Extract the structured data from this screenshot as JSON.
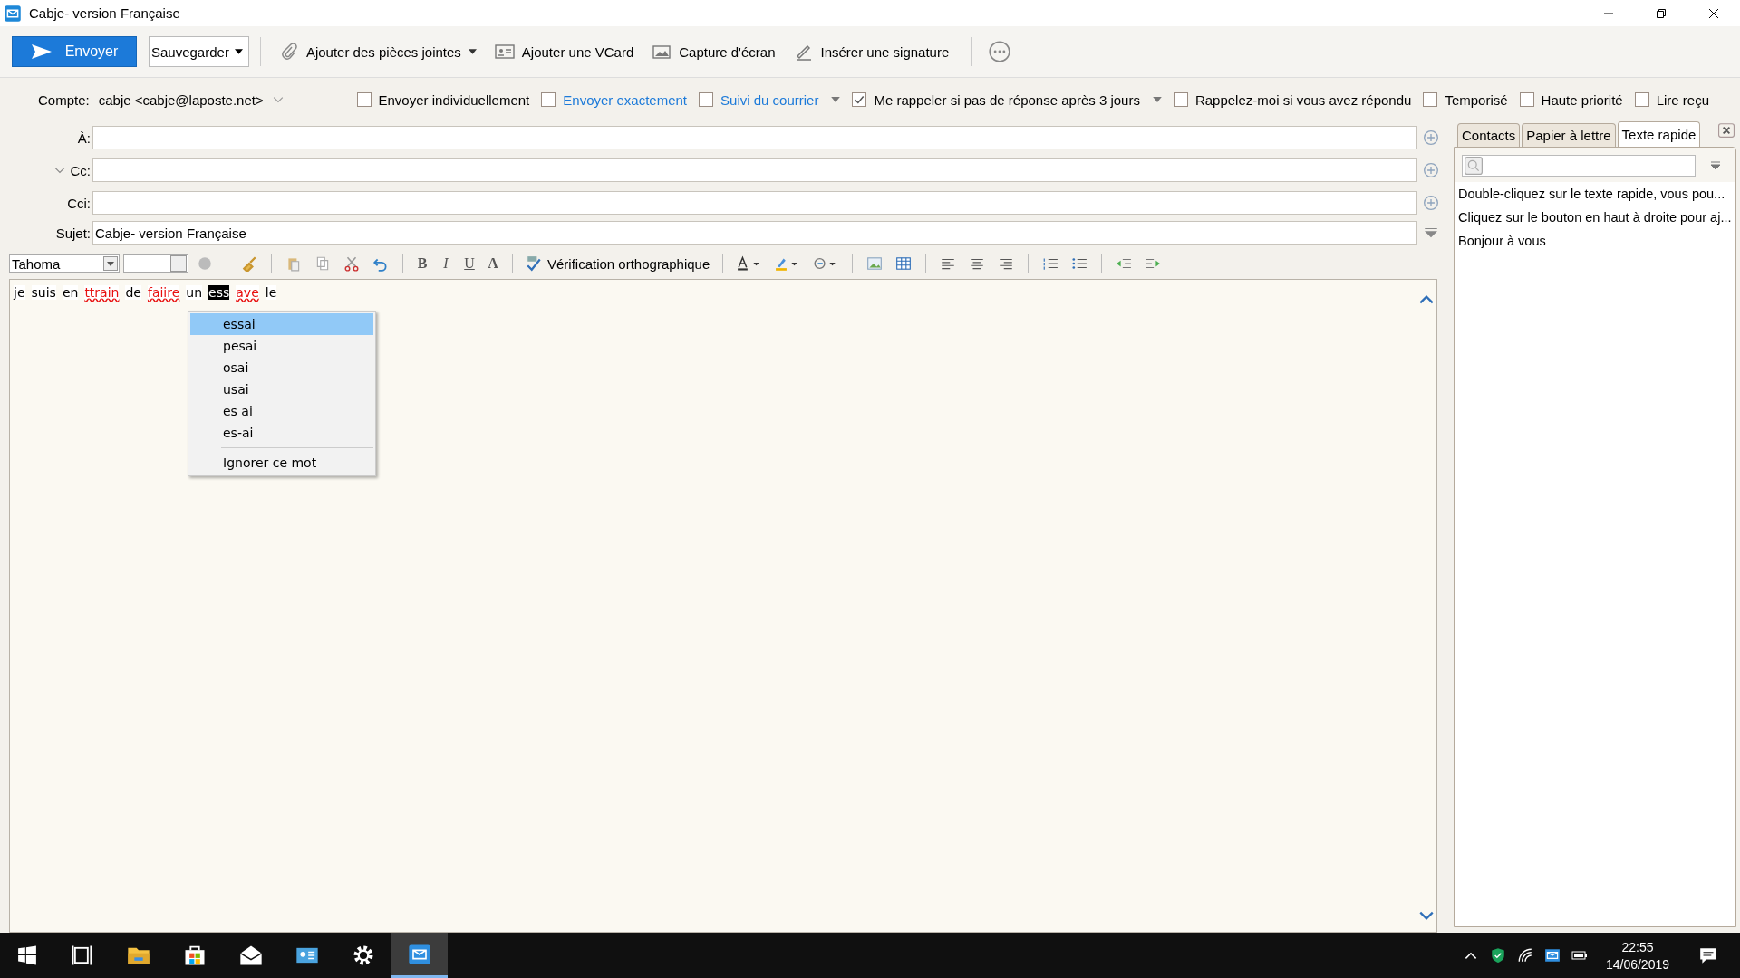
{
  "window": {
    "title": "Cabje- version Française"
  },
  "toolbar": {
    "send": "Envoyer",
    "save": "Sauvegarder",
    "actions": [
      {
        "kind": "attach",
        "label": "Ajouter des pièces jointes",
        "has_dropdown": true
      },
      {
        "kind": "vcard",
        "label": "Ajouter une VCard",
        "has_dropdown": false
      },
      {
        "kind": "capture",
        "label": "Capture d'écran",
        "has_dropdown": false
      },
      {
        "kind": "signature",
        "label": "Insérer une signature",
        "has_dropdown": false
      }
    ]
  },
  "account": {
    "label": "Compte:",
    "value": "cabje <cabje@laposte.net>"
  },
  "options": [
    {
      "label": "Envoyer individuellement",
      "checked": false,
      "link": false,
      "has_dropdown": false
    },
    {
      "label": "Envoyer exactement",
      "checked": false,
      "link": true,
      "has_dropdown": false
    },
    {
      "label": "Suivi du courrier",
      "checked": false,
      "link": true,
      "has_dropdown": true
    },
    {
      "label": "Me rappeler si pas de réponse après 3 jours",
      "checked": true,
      "link": false,
      "has_dropdown": true
    },
    {
      "label": "Rappelez-moi si vous avez répondu",
      "checked": false,
      "link": false,
      "has_dropdown": false
    },
    {
      "label": "Temporisé",
      "checked": false,
      "link": false,
      "has_dropdown": false
    },
    {
      "label": "Haute priorité",
      "checked": false,
      "link": false,
      "has_dropdown": false
    },
    {
      "label": "Lire reçu",
      "checked": false,
      "link": false,
      "has_dropdown": false
    }
  ],
  "fields": [
    {
      "label": "À:",
      "collapsible": false,
      "addable": true
    },
    {
      "label": "Cc:",
      "collapsible": true,
      "addable": true
    },
    {
      "label": "Cci:",
      "collapsible": false,
      "addable": true
    },
    {
      "label": "Sujet:",
      "value": "Cabje- version Française",
      "collapsible": false,
      "addable": false
    }
  ],
  "editor_toolbar": {
    "font": "Tahoma",
    "format": [
      "B",
      "I",
      "U",
      "A"
    ],
    "spell_check": "Vérification orthographique"
  },
  "body": {
    "words": [
      {
        "text": "je",
        "kind": "normal"
      },
      {
        "text": "suis",
        "kind": "normal"
      },
      {
        "text": "en",
        "kind": "normal"
      },
      {
        "text": "ttrain",
        "kind": "misspelled"
      },
      {
        "text": "de",
        "kind": "normal"
      },
      {
        "text": "faiire",
        "kind": "misspelled"
      },
      {
        "text": "un",
        "kind": "normal"
      },
      {
        "text": "ess",
        "kind": "selected"
      },
      {
        "text": "ave",
        "kind": "misspelled"
      },
      {
        "text": "le",
        "kind": "normal"
      }
    ]
  },
  "context_menu": {
    "suggestions": [
      {
        "text": "essai",
        "selected": true
      },
      {
        "text": "pesai",
        "selected": false
      },
      {
        "text": "osai",
        "selected": false
      },
      {
        "text": "usai",
        "selected": false
      },
      {
        "text": "es ai",
        "selected": false
      },
      {
        "text": "es-ai",
        "selected": false
      }
    ],
    "ignore": "Ignorer ce mot"
  },
  "side_panel": {
    "tabs": [
      {
        "label": "Contacts",
        "selected": false
      },
      {
        "label": "Papier à lettre",
        "selected": false
      },
      {
        "label": "Texte rapide",
        "selected": true
      }
    ],
    "items": [
      "Double-cliquez sur le texte rapide, vous pou...",
      "Cliquez sur le bouton en haut à droite pour aj...",
      "Bonjour à vous"
    ]
  },
  "taskbar": {
    "apps": [
      {
        "kind": "taskview",
        "active": false
      },
      {
        "kind": "explorer",
        "active": false
      },
      {
        "kind": "store",
        "active": false
      },
      {
        "kind": "mail",
        "active": false
      },
      {
        "kind": "contacts",
        "active": false
      },
      {
        "kind": "settings",
        "active": false
      },
      {
        "kind": "composer",
        "active": true
      }
    ],
    "time": "22:55",
    "date": "14/06/2019"
  }
}
